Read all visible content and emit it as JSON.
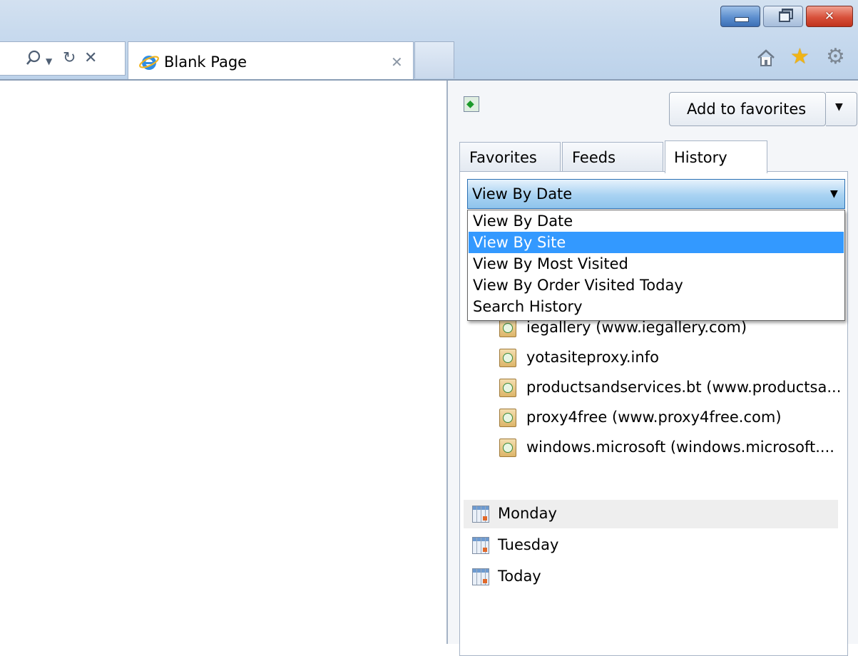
{
  "window": {
    "minimize_label": "minimize",
    "restore_label": "restore",
    "close_glyph": "✕"
  },
  "toolbar": {
    "search_icon": "search-icon",
    "refresh_icon": "refresh-icon",
    "stop_icon": "stop-icon"
  },
  "tab": {
    "title": "Blank Page",
    "close_glyph": "✕"
  },
  "command_icons": [
    "home-icon",
    "favorites-star-icon",
    "tools-gear-icon"
  ],
  "favorites_center": {
    "add_to_favorites_label": "Add to favorites",
    "tabs": [
      {
        "label": "Favorites",
        "active": false
      },
      {
        "label": "Feeds",
        "active": false
      },
      {
        "label": "History",
        "active": true
      }
    ],
    "history": {
      "view_select_value": "View By Date",
      "view_options": [
        {
          "label": "View By Date",
          "selected": false
        },
        {
          "label": "View By Site",
          "selected": true
        },
        {
          "label": "View By Most Visited",
          "selected": false
        },
        {
          "label": "View By Order Visited Today",
          "selected": false
        },
        {
          "label": "Search History",
          "selected": false
        }
      ],
      "sites": [
        "iegallery (www.iegallery.com)",
        "yotasiteproxy.info",
        "productsandservices.bt (www.productsa...",
        "proxy4free (www.proxy4free.com)",
        "windows.microsoft (windows.microsoft...."
      ],
      "days": [
        "Monday",
        "Tuesday",
        "Today"
      ]
    }
  },
  "colors": {
    "selection_highlight": "#3399ff",
    "chrome_background": "#c8daee",
    "close_button": "#d8513b",
    "favorites_star": "#f0b416"
  }
}
